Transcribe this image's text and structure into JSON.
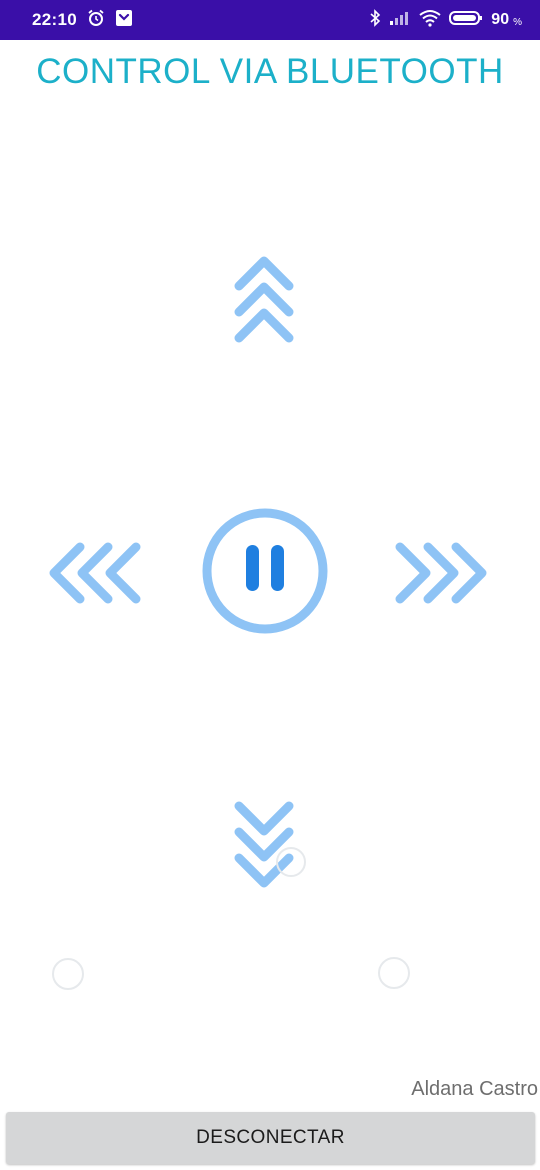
{
  "status_bar": {
    "time": "22:10",
    "battery_level": "90",
    "battery_unit": "%",
    "icons": [
      "alarm-icon",
      "notification-app-icon",
      "bluetooth-icon",
      "signal-icon",
      "wifi-icon",
      "battery-icon"
    ]
  },
  "title": "CONTROL VIA BLUETOOTH",
  "controls": {
    "forward": "double-chevron-up-icon",
    "backward": "double-chevron-down-icon",
    "left": "triple-chevron-left-icon",
    "right": "triple-chevron-right-icon",
    "stop": "pause-circle-icon"
  },
  "author": "Aldana Castro",
  "disconnect_label": "DESCONECTAR",
  "colors": {
    "status_bar": "#3a0fa8",
    "title": "#1cb0c9",
    "control_light": "#8ec3f5",
    "control_dark": "#1f7fe0",
    "button_bg": "#d5d6d7"
  }
}
